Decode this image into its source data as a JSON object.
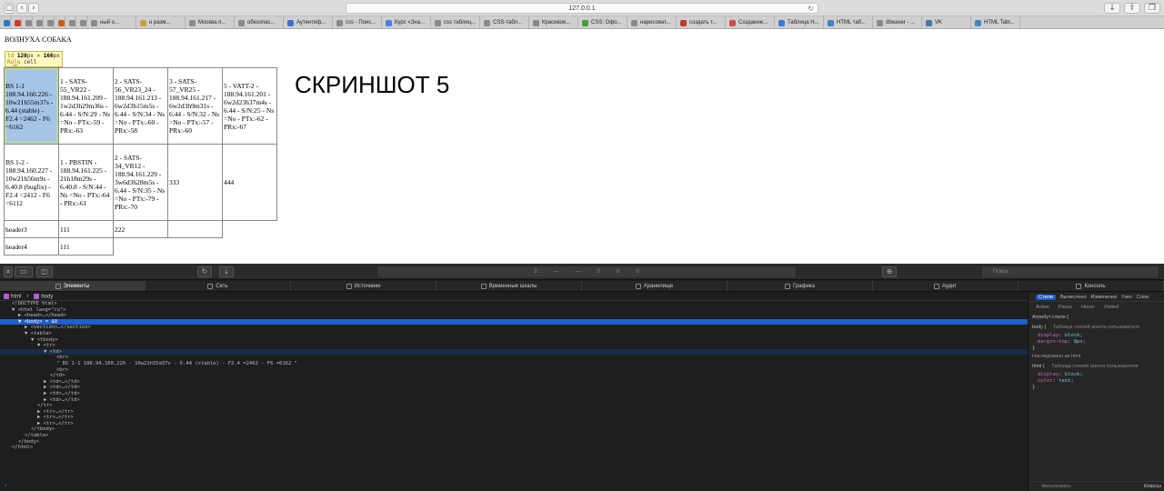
{
  "browser": {
    "url": "127.0.0.1",
    "tabs": [
      {
        "label": "",
        "color": "#2b78c2"
      },
      {
        "label": "",
        "color": "#d13a2a"
      },
      {
        "label": "",
        "color": "#8a8a8a"
      },
      {
        "label": "",
        "color": "#8a8a8a"
      },
      {
        "label": "",
        "color": "#8a8a8a"
      },
      {
        "label": "",
        "color": "#c65f21"
      },
      {
        "label": "",
        "color": "#8a8a8a"
      },
      {
        "label": "",
        "color": "#8a8a8a"
      },
      {
        "label": "ный о...",
        "color": "#8a8a8a"
      },
      {
        "label": "н разм...",
        "color": "#c7a13e"
      },
      {
        "label": "Москва п...",
        "color": "#8a8a8a"
      },
      {
        "label": "обезопас...",
        "color": "#8a8a8a"
      },
      {
        "label": "Аутентиф...",
        "color": "#3f6fd0"
      },
      {
        "label": "css - Поис...",
        "color": "#8a8a8a"
      },
      {
        "label": "Курс «Зна...",
        "color": "#4a7fe0"
      },
      {
        "label": "css таблиц...",
        "color": "#8a8a8a"
      },
      {
        "label": "CSS-табл...",
        "color": "#8a8a8a"
      },
      {
        "label": "Красивое...",
        "color": "#8a8a8a"
      },
      {
        "label": "CSS: Офо...",
        "color": "#4c9a3b"
      },
      {
        "label": "нарисоват...",
        "color": "#8a8a8a"
      },
      {
        "label": "создать т...",
        "color": "#c0392b"
      },
      {
        "label": "Создание...",
        "color": "#d14c4c"
      },
      {
        "label": "Таблица Н...",
        "color": "#3c7ad0"
      },
      {
        "label": "HTML таб...",
        "color": "#3d85c6"
      },
      {
        "label": "dbeaver - ...",
        "color": "#8a8a8a"
      },
      {
        "label": "VK",
        "color": "#4a76a8"
      },
      {
        "label": "HTML Tabl...",
        "color": "#3d85c6"
      }
    ]
  },
  "page": {
    "heading": "ВОЛНУХА СОБАКА",
    "tooltip": {
      "tag": "td",
      "width": "120",
      "height": "166",
      "unit": "px",
      "role_label": "Role",
      "role": "cell"
    },
    "big_label": "СКРИНШОТ 5",
    "table": {
      "rows": [
        [
          "BS 1-1 188.94.160.226 - 10w21h55m37s - 6.44 (stable) - F2.4 =2462 - F6 =6162",
          "1 - SATS-55_VR22 - 188.94.161.209 - 1w2d3h29m36s - 6.44 - S/N:29 - Ns =No - PTx:-59 - PRx:-63",
          "2 - SATS-56_VR23_24 - 188.94.161.213 - 6w2d3h15m5s - 6.44 - S/N:34 - Ns =No - PTx:-60 - PRx:-58",
          "3 - SATS-57_VR25 - 188.94.161.217 - 6w2d3h9m31s - 6.44 - S/N:32 - Ns =No - PTx:-57 - PRx:-60",
          "5 - VATT-2 - 188.94.161.201 - 6w2d23h37m4s - 6.44 - S/N:25 - Ns =No - PTx:-62 - PRx:-67"
        ],
        [
          "BS 1-2 - 188.94.160.227 - 10w21h56m9s - 6.40.8 (bugfix) - F2.4 =2412 - F6 =6112",
          "1 - PBSTIN - 188.94.161.225 - 21h18m29s - 6.40.8 - S/N:44 - Ns =No - PTx:-64 - PRx:-61",
          "2 - SATS-34_VR12 - 188.94.161.229 - 3w6d3h28m5s - 6.44 - S/N:35 - Ns =No - PTx:-79 - PRx:-70",
          "333",
          "444"
        ],
        [
          "header3",
          "111",
          "222",
          ""
        ],
        [
          "header4",
          "111"
        ]
      ]
    }
  },
  "devtools": {
    "toolbar_counts": [
      "2",
      "—",
      "—",
      "0",
      "0",
      "0"
    ],
    "search_placeholder": "Поиск",
    "tabs": [
      "Элементы",
      "Сеть",
      "Источники",
      "Временные шкалы",
      "Хранилище",
      "Графика",
      "Аудит",
      "Консоль"
    ],
    "breadcrumbs": [
      "html",
      "body"
    ],
    "dom_lines": [
      {
        "indent": 1,
        "html": "<!DOCTYPE html>"
      },
      {
        "indent": 1,
        "html": "▼ <html lang=\"ru\">"
      },
      {
        "indent": 2,
        "html": "▶ <head>…</head>"
      },
      {
        "indent": 2,
        "html": "▼ <body> = $0",
        "hl": true
      },
      {
        "indent": 3,
        "html": "▶ <section>…</section>"
      },
      {
        "indent": 3,
        "html": "▼ <table>"
      },
      {
        "indent": 4,
        "html": "▼ <tbody>"
      },
      {
        "indent": 5,
        "html": "▼ <tr>"
      },
      {
        "indent": 6,
        "html": "▼ <td>",
        "sub": true
      },
      {
        "indent": 8,
        "html": "<br>"
      },
      {
        "indent": 8,
        "html": "\" BS 1-1 188.94.160.226 - 10w21h55m37s - 6.44 (stable) - F2.4 =2462 - F6 =6162 \""
      },
      {
        "indent": 8,
        "html": "<br>"
      },
      {
        "indent": 7,
        "html": "</td>"
      },
      {
        "indent": 6,
        "html": "▶ <td>…</td>"
      },
      {
        "indent": 6,
        "html": "▶ <td>…</td>"
      },
      {
        "indent": 6,
        "html": "▶ <td>…</td>"
      },
      {
        "indent": 6,
        "html": "▶ <td>…</td>"
      },
      {
        "indent": 5,
        "html": "</tr>"
      },
      {
        "indent": 5,
        "html": "▶ <tr>…</tr>"
      },
      {
        "indent": 5,
        "html": "▶ <tr>…</tr>"
      },
      {
        "indent": 5,
        "html": "▶ <tr>…</tr>"
      },
      {
        "indent": 4,
        "html": "</tbody>"
      },
      {
        "indent": 3,
        "html": "</table>"
      },
      {
        "indent": 2,
        "html": "</body>"
      },
      {
        "indent": 1,
        "html": "</html>"
      }
    ],
    "sidebar": {
      "tabs": [
        "Стили",
        "Вычислено",
        "Изменения",
        "Узел",
        "Слои"
      ],
      "states": [
        "Active",
        "Focus",
        "Hover",
        "Visited"
      ],
      "style_attr": "Атрибут стиля {",
      "body_rule": {
        "selector": "body {",
        "source": "Таблица стилей агента пользователя",
        "props": [
          [
            "display",
            "block"
          ],
          [
            "margin-top",
            "8px"
          ]
        ]
      },
      "inherited": "Наследовано из html",
      "html_rule": {
        "selector": "html {",
        "source": "Таблица стилей агента пользователя",
        "props": [
          [
            "display",
            "block"
          ],
          [
            "color",
            "text"
          ]
        ]
      },
      "filter": "Фильтровать",
      "classes": "Классы"
    }
  }
}
